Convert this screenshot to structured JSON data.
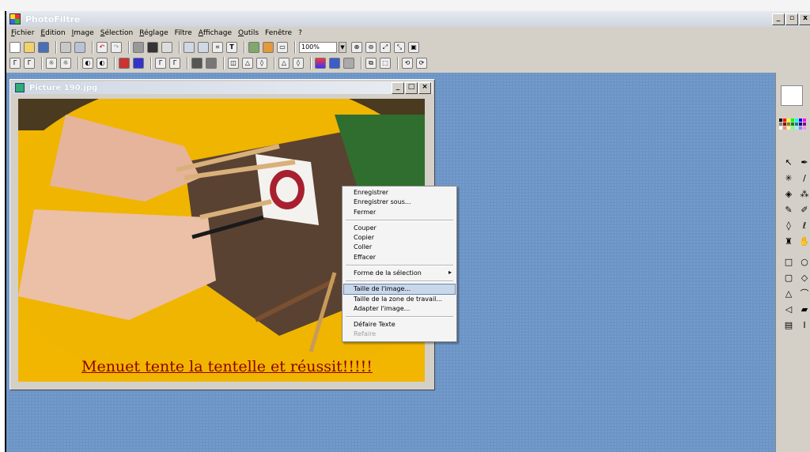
{
  "app": {
    "title": "PhotoFiltre"
  },
  "window_buttons": [
    "_",
    "▫",
    "x"
  ],
  "menu": [
    {
      "ul": "F",
      "rest": "ichier"
    },
    {
      "ul": "E",
      "rest": "dition"
    },
    {
      "ul": "I",
      "rest": "mage"
    },
    {
      "ul": "S",
      "rest": "élection"
    },
    {
      "ul": "R",
      "rest": "églage"
    },
    {
      "ul": "",
      "rest": "Filtre"
    },
    {
      "ul": "A",
      "rest": "ffichage"
    },
    {
      "ul": "O",
      "rest": "utils"
    },
    {
      "ul": "",
      "rest": "Fenêtre"
    },
    {
      "ul": "",
      "rest": "?"
    }
  ],
  "toolbar": {
    "zoom": "100%"
  },
  "image_window": {
    "title": "Picture 190.jpg",
    "buttons": [
      "_",
      "□",
      "×"
    ],
    "caption": "Menuet tente la tentelle et réussit!!!!!"
  },
  "context_menu": {
    "items": {
      "enregistrer": "Enregistrer",
      "enregistrer_sous": "Enregistrer sous...",
      "fermer": "Fermer",
      "couper": "Couper",
      "copier": "Copier",
      "coller": "Coller",
      "effacer": "Effacer",
      "forme": "Forme de la sélection",
      "taille_image": "Taille de l'image...",
      "taille_zone": "Taille de la zone de travail...",
      "adapter": "Adapter l'image...",
      "defaire": "Défaire Texte",
      "refaire": "Refaire"
    }
  },
  "colors": {
    "workspace": "#6c95c6",
    "caption": "#8b0000",
    "highlight": "#c9d7ea"
  }
}
